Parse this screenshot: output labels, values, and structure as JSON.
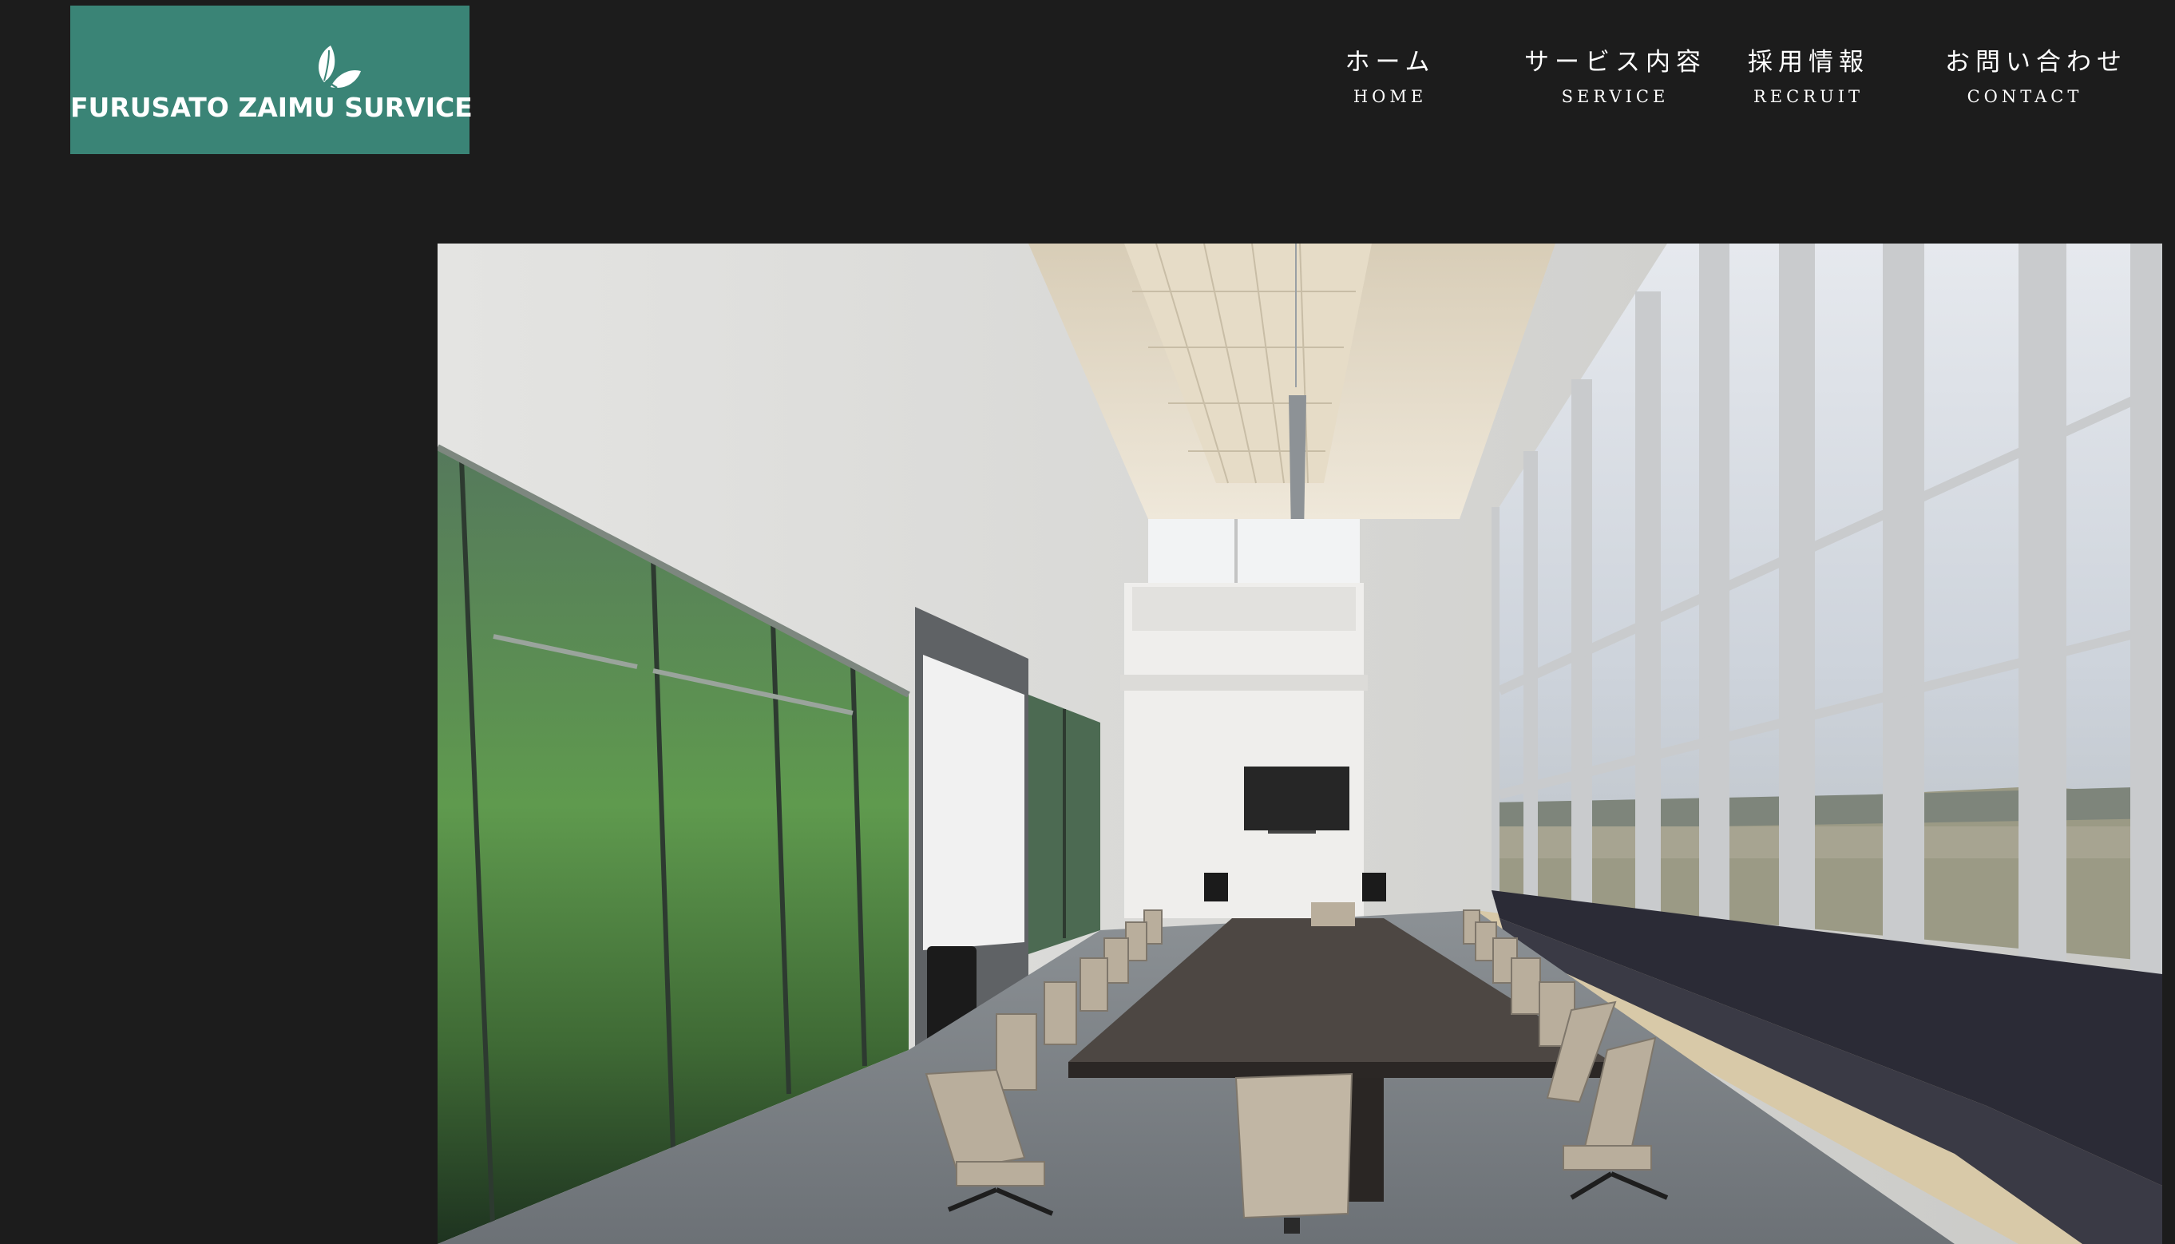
{
  "header": {
    "logo": {
      "text": "FURUSATO ZAIMU SURVICE",
      "icon": "leaf-icon",
      "background_color": "#3a8476"
    },
    "nav": [
      {
        "jp": "ホーム",
        "en": "HOME"
      },
      {
        "jp": "サービス内容",
        "en": "SERVICE"
      },
      {
        "jp": "採用情報",
        "en": "RECRUIT"
      },
      {
        "jp": "お問い合わせ",
        "en": "CONTACT"
      }
    ]
  },
  "hero": {
    "image": "conference-room-photo"
  },
  "colors": {
    "page_background": "#1c1c1c",
    "nav_text": "#ffffff"
  }
}
